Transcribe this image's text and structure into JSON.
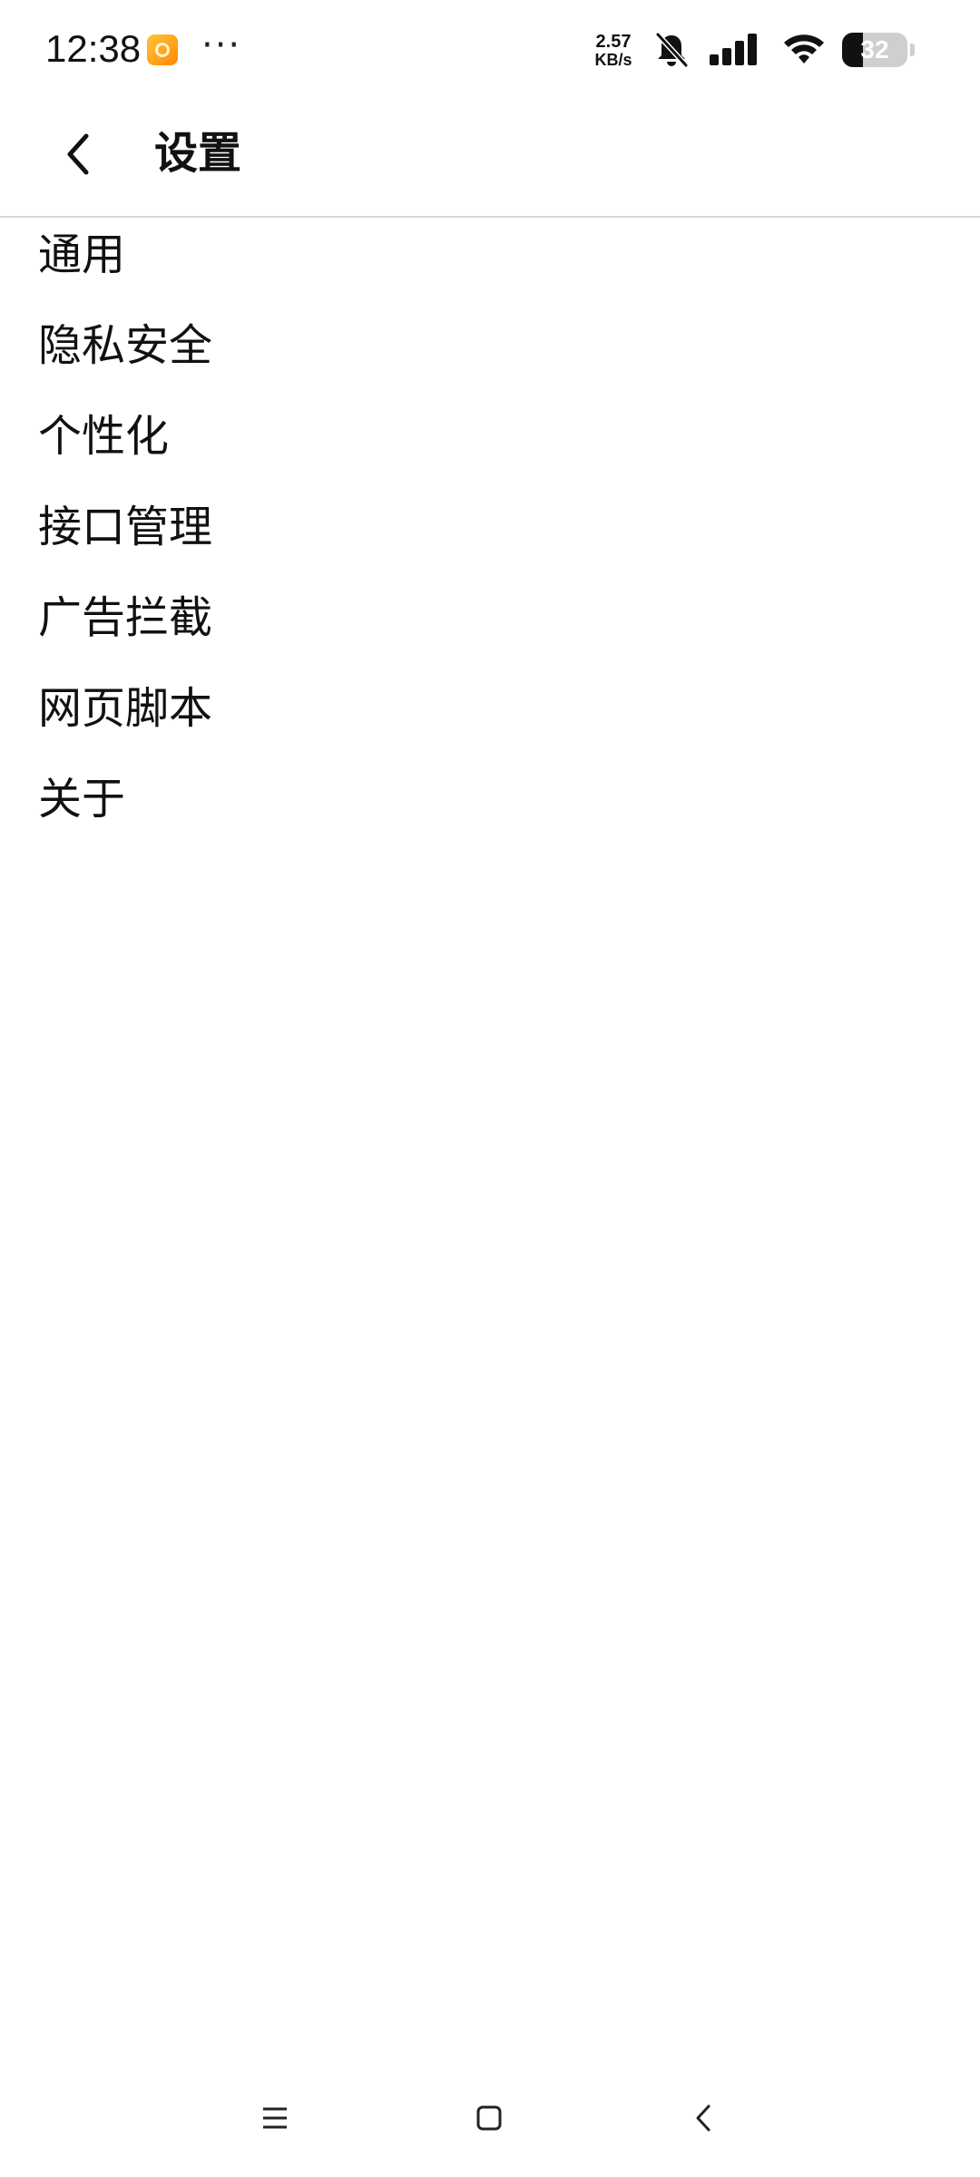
{
  "status_bar": {
    "time": "12:38",
    "more": "···",
    "net_speed_value": "2.57",
    "net_speed_unit": "KB/s",
    "battery_level": "32",
    "icons": [
      "app-notification-icon",
      "bell-off-icon",
      "signal-icon",
      "wifi-icon",
      "battery-icon"
    ]
  },
  "app_bar": {
    "title": "设置",
    "back_icon": "chevron-left-icon"
  },
  "menu": {
    "items": [
      {
        "label": "通用"
      },
      {
        "label": "隐私安全"
      },
      {
        "label": "个性化"
      },
      {
        "label": "接口管理"
      },
      {
        "label": "广告拦截"
      },
      {
        "label": "网页脚本"
      },
      {
        "label": "关于"
      }
    ]
  },
  "nav_bar": {
    "icons": [
      "menu-icon",
      "home-icon",
      "back-icon"
    ]
  },
  "colors": {
    "background": "#ffffff",
    "text": "#111111",
    "divider": "#d4d4d4",
    "battery_bg": "#cfcfcf"
  }
}
